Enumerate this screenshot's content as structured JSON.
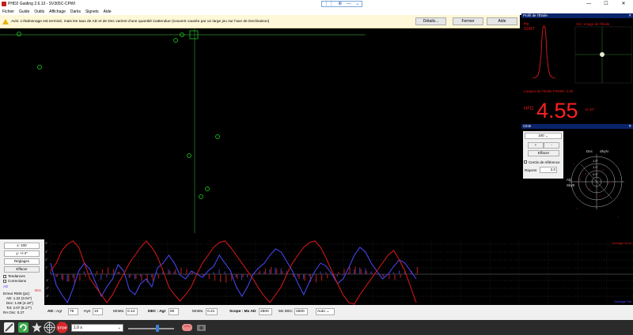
{
  "window": {
    "title": "PHD2 Guiding 2.6.13 - SV305C-CPWI",
    "floating_controls": [
      "move-icon",
      "target-icon",
      "minimize-icon",
      "dropdown-icon"
    ],
    "controls": {
      "minimize": "—",
      "maximize": "☐",
      "close": "✕"
    }
  },
  "menu": [
    "Fichier",
    "Guide",
    "Outils",
    "Affichage",
    "Darks",
    "Signets",
    "Aide"
  ],
  "infobar": {
    "message": "Avis: L'étalonnage est terminé, mais les taux de AD et de Dec varient d'une quantité inattendue (souvent causée par un large jeu sur l'axe de Declinaison)",
    "buttons": [
      "Détails...",
      "Fermer",
      "Aide"
    ]
  },
  "profile_panel": {
    "title": "Profil de l'Étoile",
    "mode_label": "Ho",
    "mode_value": "52467",
    "click_hint": "Clic: image de l'étoile",
    "fwhm_text": "Largeur de l'étoile FWHM: 3.48",
    "hfd_label": "HFD",
    "hfd_value": "4.55",
    "hfd_unit": "11.26\""
  },
  "star_panel": {
    "title": "Cible",
    "zoom_value": "100",
    "plus_label": "+",
    "minus_label": "-",
    "clear_label": "Effacer",
    "ref_circle_label": "Cercle de référence",
    "radius_label": "Rayons",
    "radius_value": "2.0",
    "target_labels": {
      "dec": "Dec",
      "skyn": "SkyN",
      "ad": "AD",
      "skye": "SkyE",
      "r1": "1.5\"",
      "r2": "1.0\"",
      "r3": "0.5\""
    }
  },
  "history": {
    "title": "Historique",
    "x_value": "x: 100",
    "y_value": "y: +/-4\"",
    "settings_label": "Réglages",
    "clear_label": "Effacer",
    "trends_label": "Tendances",
    "corrections_label": "Corrections",
    "ad_label": "AD",
    "dec_label": "Dec",
    "rms_title": "Erreur RMS (px):",
    "rms_ad": "AD: 1.22 (3.04\")",
    "rms_dec": "Dec: 1.68 (4.18\")",
    "rms_tot": "Tot: 2.07 (5.17\")",
    "ra_osc": "RA Osc: 0.27",
    "y_ticks": [
      "4\"",
      "3\"",
      "2\"",
      "1\"",
      "-1\"",
      "-2\"",
      "-3\""
    ],
    "corner_top": "Guidage Nord",
    "corner_bottom": "Guidage Est",
    "params": {
      "ad_label": "AD :",
      "agr_label": "Agr",
      "agr_value": "75",
      "hys_label": "Hys",
      "hys_value": "10",
      "minmo_label": "MnMo",
      "minmo_value": "0.14",
      "dec_label": "DEC : Agr",
      "dec_agr_value": "80",
      "dec_minmo_label": "MnMo",
      "dec_minmo_value": "0.21",
      "scope_label": "Scope : Mx AD",
      "mx_ad_value": "2500",
      "mx_dec_label": "Mx DEC",
      "mx_dec_value": "2500",
      "auto_value": "Auto"
    }
  },
  "toolbar": {
    "exposure_value": "1.0 s",
    "stop_label": "STOP"
  },
  "colors": {
    "ra": "#4a4aff",
    "dec": "#e01818",
    "crosshair": "#2a8a2a",
    "star_circle": "#22dd22",
    "profile": "#e01818",
    "panel_head": "#0a246a"
  }
}
